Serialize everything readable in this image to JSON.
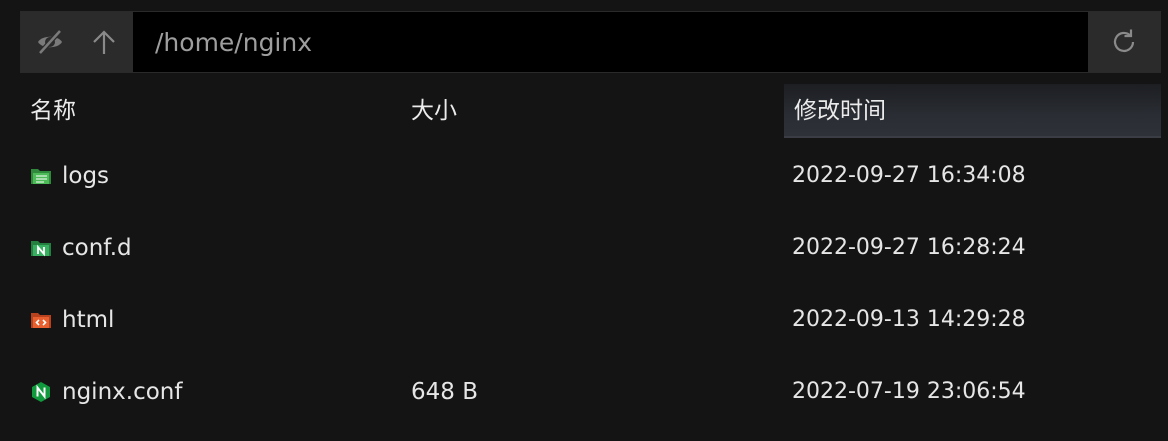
{
  "toolbar": {
    "hidden_toggle_icon": "eye-off-icon",
    "up_icon": "arrow-up-icon",
    "path_value": "/home/nginx",
    "refresh_icon": "refresh-icon"
  },
  "columns": {
    "name": "名称",
    "size": "大小",
    "modified": "修改时间"
  },
  "files": [
    {
      "name": "logs",
      "size": "",
      "modified": "2022-09-27 16:34:08",
      "icon": "folder-logs-icon",
      "color": "#3fa34d"
    },
    {
      "name": "conf.d",
      "size": "",
      "modified": "2022-09-27 16:28:24",
      "icon": "folder-nginx-icon",
      "color": "#2eaa5a"
    },
    {
      "name": "html",
      "size": "",
      "modified": "2022-09-13 14:29:28",
      "icon": "folder-html-icon",
      "color": "#e2582c"
    },
    {
      "name": "nginx.conf",
      "size": "648 B",
      "modified": "2022-07-19 23:06:54",
      "icon": "nginx-icon",
      "color": "#119a3d"
    }
  ]
}
